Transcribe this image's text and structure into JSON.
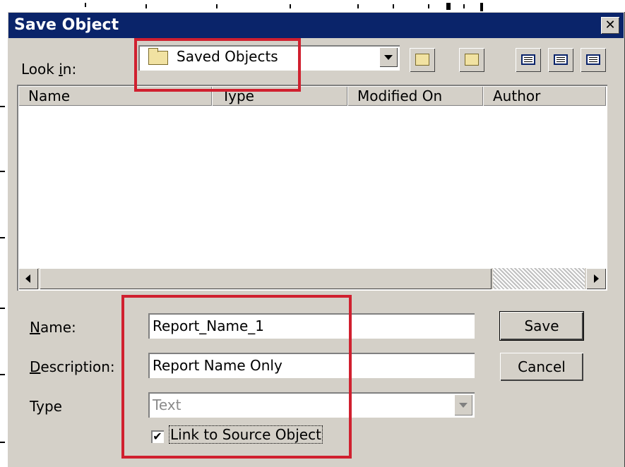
{
  "window": {
    "title": "Save Object",
    "close_label": "✕"
  },
  "look_in": {
    "label_pre": "Look ",
    "label_accel": "i",
    "label_post": "n:",
    "value": "Saved Objects"
  },
  "toolbar": {
    "up_icon": "up-folder-icon",
    "new_folder_icon": "new-folder-icon",
    "view_icons": [
      "list-view-icon",
      "details-view-icon",
      "thumbnail-view-icon"
    ]
  },
  "file_list": {
    "columns": [
      "Name",
      "Type",
      "Modified On",
      "Author"
    ]
  },
  "form": {
    "name_label_accel": "N",
    "name_label_rest": "ame:",
    "name_value": "Report_Name_1",
    "desc_label_accel": "D",
    "desc_label_rest": "escription:",
    "desc_value": "Report Name Only",
    "type_label": "Type",
    "type_value": "Text",
    "checkbox_mark": "✔",
    "checkbox_label": "Link to Source Object"
  },
  "buttons": {
    "save": "Save",
    "cancel": "Cancel"
  },
  "colors": {
    "titlebar": "#0a246a",
    "highlight_box": "#d0202f",
    "dialog_bg": "#d4d0c8"
  }
}
